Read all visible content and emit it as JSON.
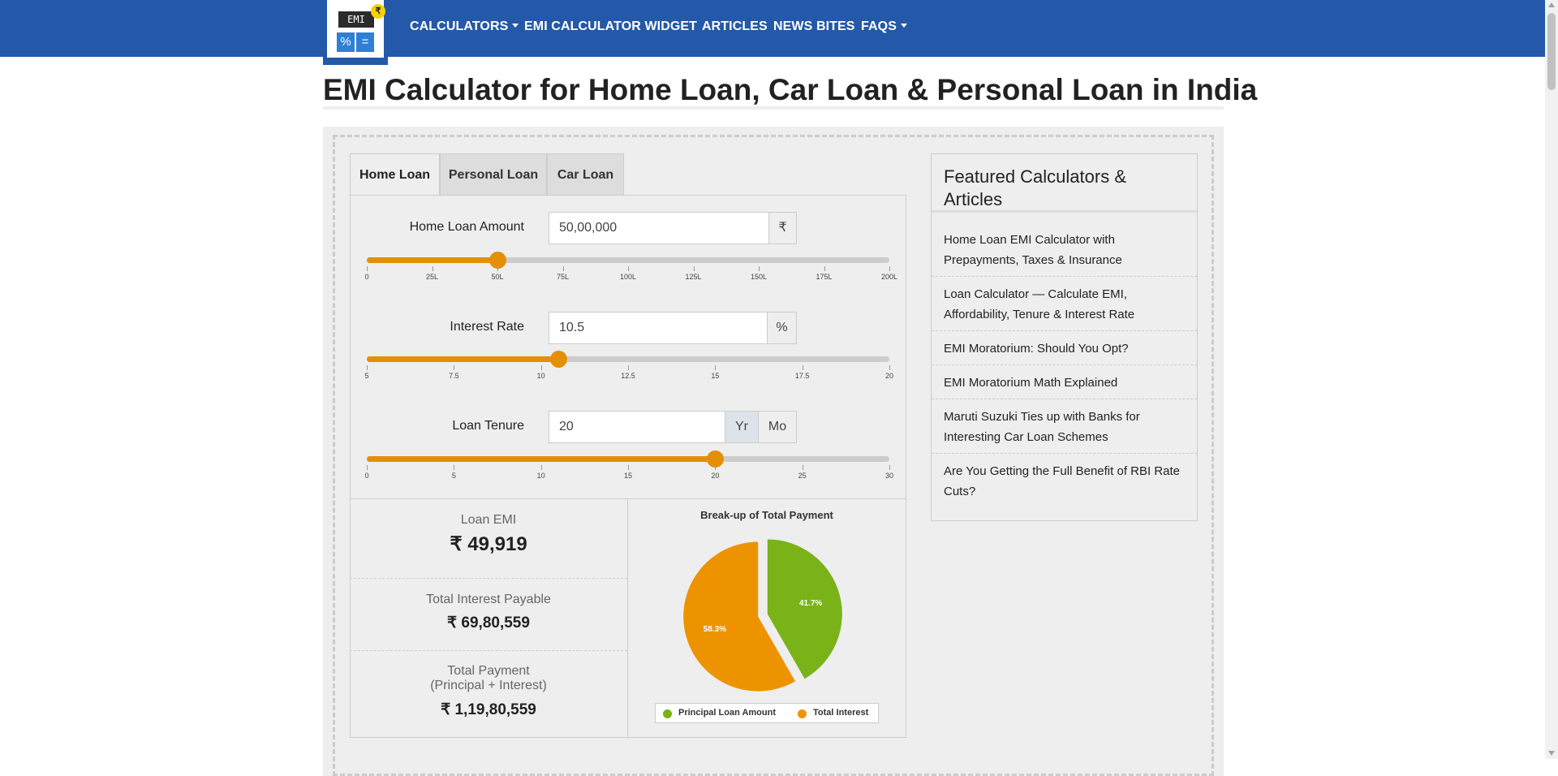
{
  "nav": {
    "logo": {
      "screen_text": "EMI",
      "key1": "%",
      "key2": "=",
      "coin": "₹"
    },
    "links": [
      {
        "label": "CALCULATORS",
        "dropdown": true
      },
      {
        "label": "EMI CALCULATOR WIDGET",
        "dropdown": false
      },
      {
        "label": "ARTICLES",
        "dropdown": false
      },
      {
        "label": "NEWS BITES",
        "dropdown": false
      },
      {
        "label": "FAQS",
        "dropdown": true
      }
    ]
  },
  "page": {
    "title": "EMI Calculator for Home Loan, Car Loan & Personal Loan in India"
  },
  "tabs": [
    {
      "label": "Home Loan",
      "active": true
    },
    {
      "label": "Personal Loan",
      "active": false
    },
    {
      "label": "Car Loan",
      "active": false
    }
  ],
  "inputs": {
    "amount": {
      "label": "Home Loan Amount",
      "value": "50,00,000",
      "unit": "₹",
      "slider_min": 0,
      "slider_max": 200,
      "slider_value": 50,
      "ticks": [
        "0",
        "25L",
        "50L",
        "75L",
        "100L",
        "125L",
        "150L",
        "175L",
        "200L"
      ]
    },
    "rate": {
      "label": "Interest Rate",
      "value": "10.5",
      "unit": "%",
      "slider_min": 5,
      "slider_max": 20,
      "slider_value": 10.5,
      "ticks": [
        "5",
        "7.5",
        "10",
        "12.5",
        "15",
        "17.5",
        "20"
      ]
    },
    "tenure": {
      "label": "Loan Tenure",
      "value": "20",
      "unit_year": "Yr",
      "unit_month": "Mo",
      "slider_min": 0,
      "slider_max": 30,
      "slider_value": 20,
      "ticks": [
        "0",
        "5",
        "10",
        "15",
        "20",
        "25",
        "30"
      ]
    }
  },
  "results": {
    "emi_label": "Loan EMI",
    "emi_value": "₹ 49,919",
    "interest_label": "Total Interest Payable",
    "interest_value": "₹ 69,80,559",
    "total_label_1": "Total Payment",
    "total_label_2": "(Principal + Interest)",
    "total_value": "₹ 1,19,80,559"
  },
  "chart_data": {
    "type": "pie",
    "title": "Break-up of Total Payment",
    "slices": [
      {
        "name": "Principal Loan Amount",
        "value": 41.7,
        "label": "41.7%",
        "color": "#7ab317"
      },
      {
        "name": "Total Interest",
        "value": 58.3,
        "label": "58.3%",
        "color": "#ee9300"
      }
    ],
    "legend_position": "bottom"
  },
  "featured": {
    "title": "Featured Calculators & Articles",
    "items": [
      "Home Loan EMI Calculator with Prepayments, Taxes & Insurance",
      "Loan Calculator — Calculate EMI, Affordability, Tenure & Interest Rate",
      "EMI Moratorium: Should You Opt?",
      "EMI Moratorium Math Explained",
      "Maruti Suzuki Ties up with Banks for Interesting Car Loan Schemes",
      "Are You Getting the Full Benefit of RBI Rate Cuts?"
    ]
  },
  "colors": {
    "nav_bg": "#2359a8",
    "accent_orange": "#e48f06",
    "principal_green": "#7ab317"
  }
}
